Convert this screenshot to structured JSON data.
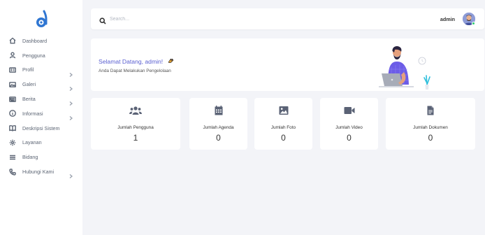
{
  "sidebar": {
    "items": [
      {
        "label": "Dashboard",
        "icon": "home-icon",
        "has_submenu": false
      },
      {
        "label": "Pengguna",
        "icon": "user-icon",
        "has_submenu": false
      },
      {
        "label": "Profil",
        "icon": "id-card-icon",
        "has_submenu": true
      },
      {
        "label": "Galeri",
        "icon": "image-icon",
        "has_submenu": true
      },
      {
        "label": "Berita",
        "icon": "newspaper-icon",
        "has_submenu": true
      },
      {
        "label": "Informasi",
        "icon": "info-icon",
        "has_submenu": true
      },
      {
        "label": "Deskripsi Sistem",
        "icon": "book-icon",
        "has_submenu": false
      },
      {
        "label": "Layanan",
        "icon": "gear-icon",
        "has_submenu": false
      },
      {
        "label": "Bidang",
        "icon": "list-icon",
        "has_submenu": false
      },
      {
        "label": "Hubungi Kami",
        "icon": "phone-icon",
        "has_submenu": true
      }
    ]
  },
  "search": {
    "placeholder": "Search..."
  },
  "user": {
    "name": "admin"
  },
  "welcome": {
    "title": "Selamat Datang, admin!",
    "subtitle": "Anda Dapat Melakukan Pengelolaan"
  },
  "stats": [
    {
      "label": "Jumlah Pengguna",
      "value": "1",
      "icon": "users-icon"
    },
    {
      "label": "Jumlah Agenda",
      "value": "0",
      "icon": "calendar-icon"
    },
    {
      "label": "Jumlah Foto",
      "value": "0",
      "icon": "photo-icon"
    },
    {
      "label": "Jumlah Video",
      "value": "0",
      "icon": "video-icon"
    },
    {
      "label": "Jumlah Dokumen",
      "value": "0",
      "icon": "document-icon"
    }
  ],
  "colors": {
    "accent": "#5a5fd1",
    "logo": "#2f76d2",
    "background": "#f3f4f8",
    "text_muted": "#5b6473"
  }
}
